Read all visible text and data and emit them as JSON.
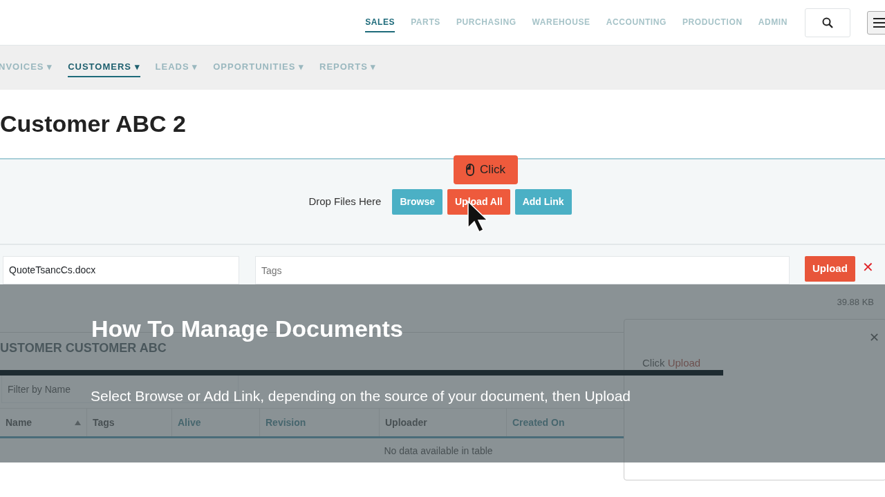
{
  "top_nav": [
    {
      "label": "SALES",
      "selected": true
    },
    {
      "label": "PARTS",
      "selected": false
    },
    {
      "label": "PURCHASING",
      "selected": false
    },
    {
      "label": "WAREHOUSE",
      "selected": false
    },
    {
      "label": "ACCOUNTING",
      "selected": false
    },
    {
      "label": "PRODUCTION",
      "selected": false
    },
    {
      "label": "ADMIN",
      "selected": false
    }
  ],
  "sub_nav": [
    {
      "label": "NVOICES ▾",
      "selected": false
    },
    {
      "label": "CUSTOMERS ▾",
      "selected": true
    },
    {
      "label": "LEADS ▾",
      "selected": false
    },
    {
      "label": "OPPORTUNITIES ▾",
      "selected": false
    },
    {
      "label": "REPORTS ▾",
      "selected": false
    }
  ],
  "page_title": "Customer ABC 2",
  "upload_zone": {
    "label": "Drop Files Here",
    "buttons": [
      {
        "label": "Browse",
        "kind": "secondary"
      },
      {
        "label": "Upload All",
        "kind": "primary"
      },
      {
        "label": "Add Link",
        "kind": "secondary"
      }
    ],
    "tooltip": "Click"
  },
  "file_row": {
    "filename": "QuoteTsancCs.docx",
    "tags_placeholder": "Tags",
    "upload_button": "Upload",
    "remove": "✕",
    "size": "39.88 KB"
  },
  "documents": {
    "heading": "USTOMER CUSTOMER ABC",
    "filter_placeholder": "Filter by Name",
    "columns": [
      {
        "label": "Name",
        "link": false,
        "sorted": true
      },
      {
        "label": "Tags",
        "link": false,
        "sorted": false
      },
      {
        "label": "Alive",
        "link": true,
        "sorted": false
      },
      {
        "label": "Revision",
        "link": true,
        "sorted": false
      },
      {
        "label": "Uploader",
        "link": false,
        "sorted": false
      },
      {
        "label": "Created On",
        "link": true,
        "sorted": false
      }
    ],
    "empty": "No data available in table"
  },
  "tutorial": {
    "title": "How To Manage Documents",
    "text": "Select Browse or Add Link, depending on the source of your document, then Upload",
    "close": "✕",
    "step": {
      "prefix": "Click",
      "target": "Upload"
    }
  }
}
